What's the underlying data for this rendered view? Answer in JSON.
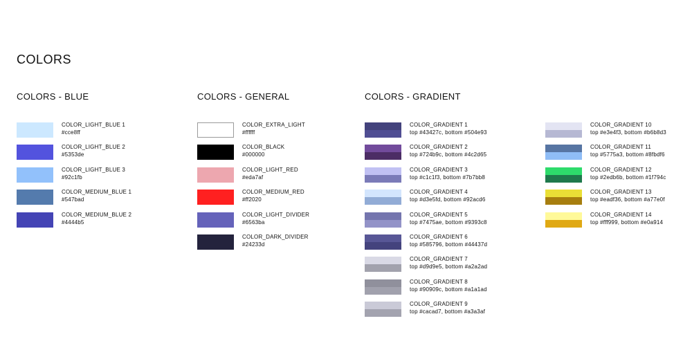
{
  "page_title": "COLORS",
  "blue": {
    "title": "COLORS - BLUE",
    "items": [
      {
        "name": "COLOR_LIGHT_BLUE 1",
        "value": "#cce8ff",
        "color": "#cce8ff"
      },
      {
        "name": "COLOR_LIGHT_BLUE 2",
        "value": "#5353de",
        "color": "#5353de"
      },
      {
        "name": "COLOR_LIGHT_BLUE 3",
        "value": "#92c1fb",
        "color": "#92c1fb"
      },
      {
        "name": "COLOR_MEDIUM_BLUE 1",
        "value": "#547bad",
        "color": "#547bad"
      },
      {
        "name": "COLOR_MEDIUM_BLUE 2",
        "value": "#4444b5",
        "color": "#4444b5"
      }
    ]
  },
  "general": {
    "title": "COLORS - GENERAL",
    "items": [
      {
        "name": "COLOR_EXTRA_LIGHT",
        "value": "#ffffff",
        "color": "#ffffff",
        "outlined": true
      },
      {
        "name": "COLOR_BLACK",
        "value": "#000000",
        "color": "#000000"
      },
      {
        "name": "COLOR_LIGHT_RED",
        "value": "#eda7af",
        "color": "#eda7af"
      },
      {
        "name": "COLOR_MEDIUM_RED",
        "value": "#ff2020",
        "color": "#ff2020"
      },
      {
        "name": "COLOR_LIGHT_DIVIDER",
        "value": "#6563ba",
        "color": "#6563ba"
      },
      {
        "name": "COLOR_DARK_DIVIDER",
        "value": "#24233d",
        "color": "#24233d"
      }
    ]
  },
  "gradient": {
    "title": "COLORS - GRADIENT",
    "items": [
      {
        "name": "COLOR_GRADIENT 1",
        "value": "top #43427c, bottom #504e93",
        "top": "#43427c",
        "bottom": "#504e93"
      },
      {
        "name": "COLOR_GRADIENT 2",
        "value": "top #724b9c, bottom #4c2d65",
        "top": "#724b9c",
        "bottom": "#4c2d65"
      },
      {
        "name": "COLOR_GRADIENT 3",
        "value": "top #c1c1f3, bottom #7b7bb8",
        "top": "#c1c1f3",
        "bottom": "#7b7bb8"
      },
      {
        "name": "COLOR_GRADIENT 4",
        "value": "top #d3e5fd, bottom #92acd6",
        "top": "#d3e5fd",
        "bottom": "#92acd6"
      },
      {
        "name": "COLOR_GRADIENT 5",
        "value": "top #7475ae, bottom #9393c8",
        "top": "#7475ae",
        "bottom": "#9393c8"
      },
      {
        "name": "COLOR_GRADIENT 6",
        "value": "top #585796, bottom #44437d",
        "top": "#585796",
        "bottom": "#44437d"
      },
      {
        "name": "COLOR_GRADIENT 7",
        "value": "top #d9d9e5, bottom #a2a2ad",
        "top": "#d9d9e5",
        "bottom": "#a2a2ad"
      },
      {
        "name": "COLOR_GRADIENT 8",
        "value": "top #90909c, bottom #a1a1ad",
        "top": "#90909c",
        "bottom": "#a1a1ad"
      },
      {
        "name": "COLOR_GRADIENT 9",
        "value": "top #cacad7, bottom #a3a3af",
        "top": "#cacad7",
        "bottom": "#a3a3af"
      },
      {
        "name": "COLOR_GRADIENT 10",
        "value": "top #e3e4f3, bottom #b6b8d3",
        "top": "#e3e4f3",
        "bottom": "#b6b8d3"
      },
      {
        "name": "COLOR_GRADIENT 11",
        "value": "top #5775a3, bottom #8fbdf6",
        "top": "#5775a3",
        "bottom": "#8fbdf6"
      },
      {
        "name": "COLOR_GRADIENT 12",
        "value": "top #2edb6b, bottom #1f794c",
        "top": "#2edb6b",
        "bottom": "#1f794c"
      },
      {
        "name": "COLOR_GRADIENT 13",
        "value": "top #eadf36, bottom #a77e0f",
        "top": "#eadf36",
        "bottom": "#a77e0f"
      },
      {
        "name": "COLOR_GRADIENT 14",
        "value": "top #fff999, bottom #e0a914",
        "top": "#fff999",
        "bottom": "#e0a914"
      }
    ]
  }
}
